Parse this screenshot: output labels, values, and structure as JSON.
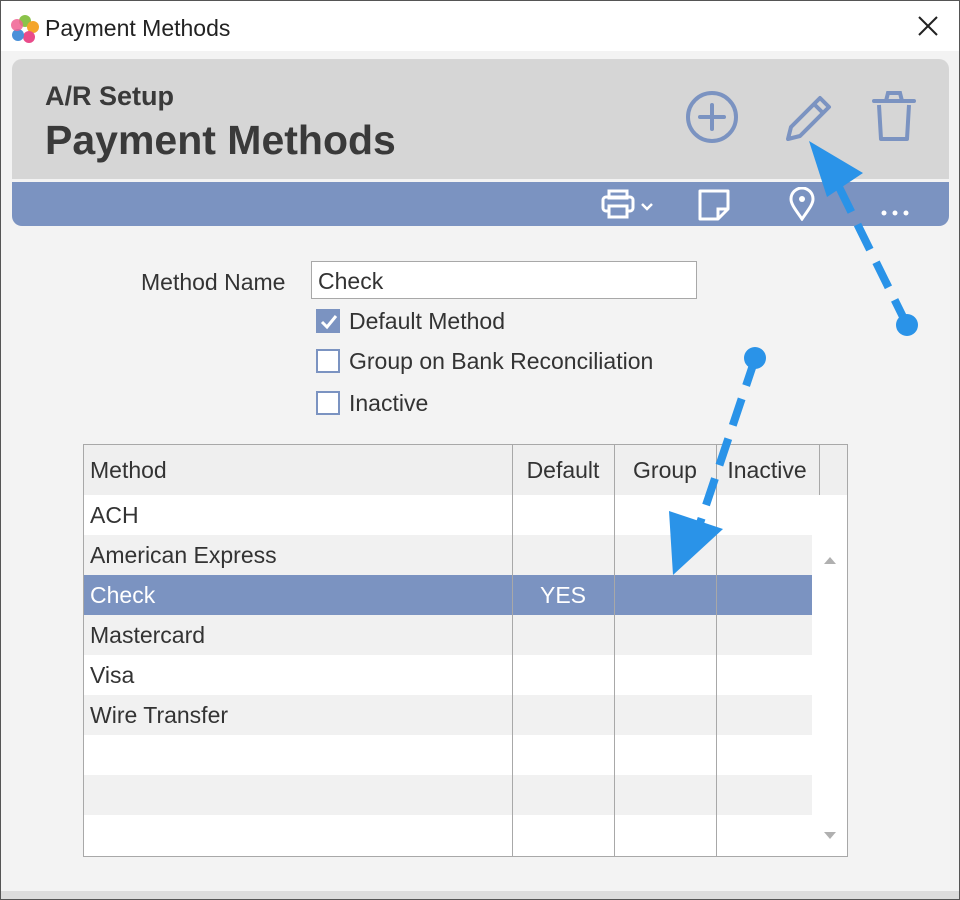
{
  "window": {
    "title": "Payment Methods"
  },
  "header": {
    "subtitle": "A/R Setup",
    "title": "Payment Methods"
  },
  "form": {
    "method_name_label": "Method Name",
    "method_name_value": "Check",
    "checkboxes": [
      {
        "label": "Default Method",
        "checked": true
      },
      {
        "label": "Group on Bank Reconciliation",
        "checked": false
      },
      {
        "label": "Inactive",
        "checked": false
      }
    ]
  },
  "grid": {
    "columns": [
      "Method",
      "Default",
      "Group",
      "Inactive"
    ],
    "rows": [
      {
        "method": "ACH",
        "default": ""
      },
      {
        "method": "American Express",
        "default": ""
      },
      {
        "method": "Check",
        "default": "YES",
        "selected": true
      },
      {
        "method": "Mastercard",
        "default": ""
      },
      {
        "method": "Visa",
        "default": ""
      },
      {
        "method": "Wire Transfer",
        "default": ""
      }
    ]
  },
  "colors": {
    "accent": "#7b93c1",
    "annotation": "#2a93e8",
    "header_bg": "#d6d6d6"
  },
  "icons": [
    "add-icon",
    "edit-icon",
    "delete-icon",
    "print-icon",
    "note-icon",
    "pin-icon",
    "more-icon",
    "close-icon"
  ]
}
